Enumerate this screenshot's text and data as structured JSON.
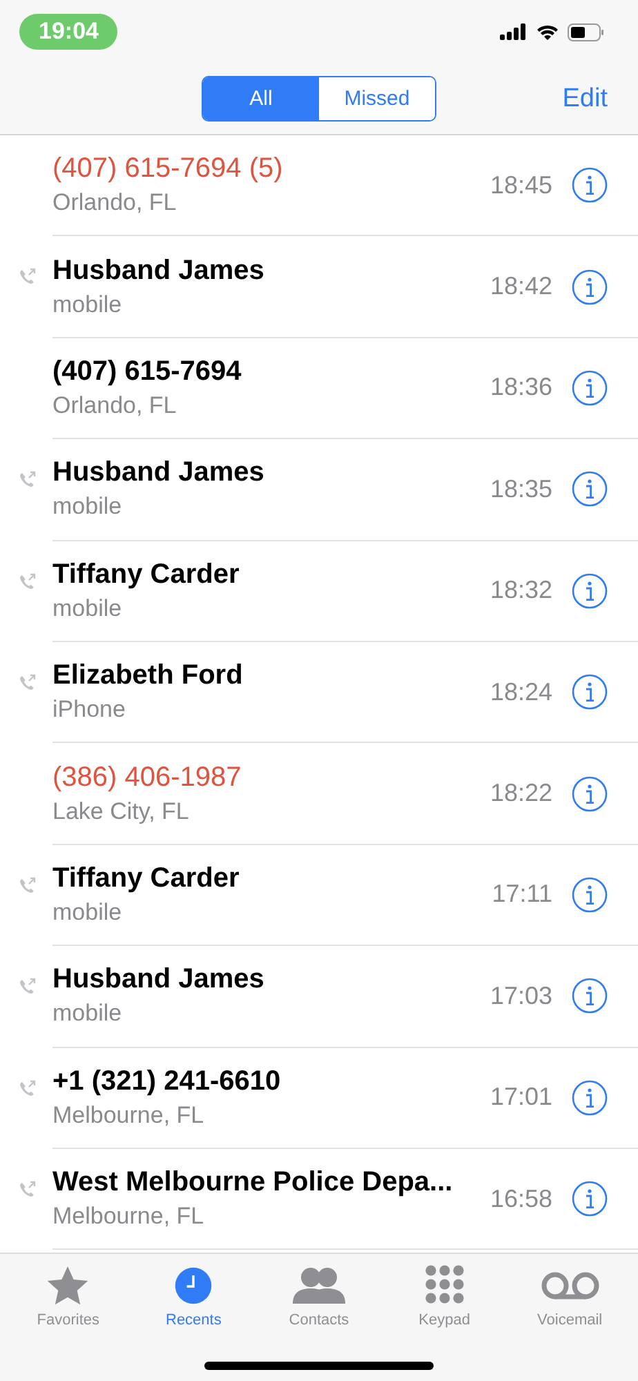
{
  "status_bar": {
    "time": "19:04"
  },
  "segments": [
    {
      "label": "All",
      "selected": true
    },
    {
      "label": "Missed",
      "selected": false
    }
  ],
  "edit": "Edit",
  "calls": [
    {
      "name": "(407) 615-7694 (5)",
      "detail": "Orlando, FL",
      "time": "18:45",
      "missed": true,
      "outgoing": false
    },
    {
      "name": "Husband James",
      "detail": "mobile",
      "time": "18:42",
      "missed": false,
      "outgoing": true
    },
    {
      "name": "(407) 615-7694",
      "detail": "Orlando, FL",
      "time": "18:36",
      "missed": false,
      "outgoing": false
    },
    {
      "name": "Husband James",
      "detail": "mobile",
      "time": "18:35",
      "missed": false,
      "outgoing": true
    },
    {
      "name": "Tiffany Carder",
      "detail": "mobile",
      "time": "18:32",
      "missed": false,
      "outgoing": true
    },
    {
      "name": "Elizabeth Ford",
      "detail": "iPhone",
      "time": "18:24",
      "missed": false,
      "outgoing": true
    },
    {
      "name": "(386) 406-1987",
      "detail": "Lake City, FL",
      "time": "18:22",
      "missed": true,
      "outgoing": false
    },
    {
      "name": "Tiffany Carder",
      "detail": "mobile",
      "time": "17:11",
      "missed": false,
      "outgoing": true
    },
    {
      "name": "Husband James",
      "detail": "mobile",
      "time": "17:03",
      "missed": false,
      "outgoing": true
    },
    {
      "name": "+1 (321) 241-6610",
      "detail": "Melbourne, FL",
      "time": "17:01",
      "missed": false,
      "outgoing": true
    },
    {
      "name": "West Melbourne Police Depa...",
      "detail": "Melbourne, FL",
      "time": "16:58",
      "missed": false,
      "outgoing": true
    }
  ],
  "tabs": [
    {
      "label": "Favorites",
      "kind": "star",
      "selected": false
    },
    {
      "label": "Recents",
      "kind": "clock",
      "selected": true
    },
    {
      "label": "Contacts",
      "kind": "people",
      "selected": false
    },
    {
      "label": "Keypad",
      "kind": "keypad",
      "selected": false
    },
    {
      "label": "Voicemail",
      "kind": "voicemail",
      "selected": false
    }
  ]
}
